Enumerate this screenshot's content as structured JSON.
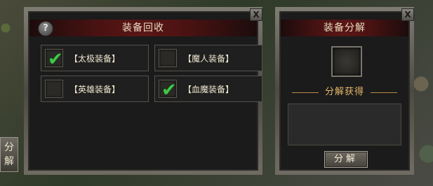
{
  "side_tab": {
    "label_line1": "分",
    "label_line2": "解"
  },
  "recycle_panel": {
    "title": "装备回收",
    "close_glyph": "X",
    "help_glyph": "?",
    "options": [
      {
        "label": "【太极装备】",
        "checked": true
      },
      {
        "label": "【魔人装备】",
        "checked": false
      },
      {
        "label": "【英雄装备】",
        "checked": false
      },
      {
        "label": "【血魔装备】",
        "checked": true
      }
    ]
  },
  "decompose_panel": {
    "title": "装备分解",
    "close_glyph": "X",
    "result_label": "分解获得",
    "button_label": "分解"
  },
  "colors": {
    "check": "#3fc94a",
    "title_bg": "#5a1616",
    "divider": "#e4b56a"
  },
  "icons": {
    "check": "✔"
  }
}
